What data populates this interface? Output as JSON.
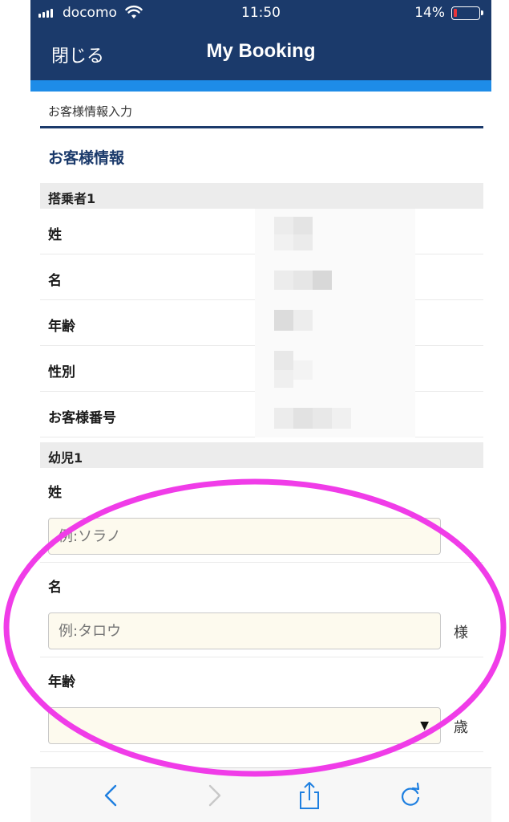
{
  "status_bar": {
    "carrier": "docomo",
    "time": "11:50",
    "battery": "14%",
    "battery_level": 0.14
  },
  "nav": {
    "close_label": "閉じる",
    "title": "My Booking"
  },
  "step_label": "お客様情報入力",
  "section_title": "お客様情報",
  "passenger": {
    "header": "搭乗者1",
    "fields": [
      {
        "label": "姓"
      },
      {
        "label": "名"
      },
      {
        "label": "年齢"
      },
      {
        "label": "性別"
      },
      {
        "label": "お客様番号"
      }
    ]
  },
  "infant": {
    "header": "幼児1",
    "last_name": {
      "label": "姓",
      "placeholder": "例:ソラノ"
    },
    "first_name": {
      "label": "名",
      "placeholder": "例:タロウ",
      "suffix": "様"
    },
    "age": {
      "label": "年齢",
      "value": "",
      "suffix": "歳"
    }
  },
  "toolbar": {
    "icons": [
      "back-icon",
      "forward-icon",
      "share-icon",
      "reload-icon"
    ]
  },
  "colors": {
    "nav_bg": "#1b3a6b",
    "accent": "#1e8ce8",
    "annotation": "#f03ce8",
    "input_bg": "#fdfaee"
  }
}
